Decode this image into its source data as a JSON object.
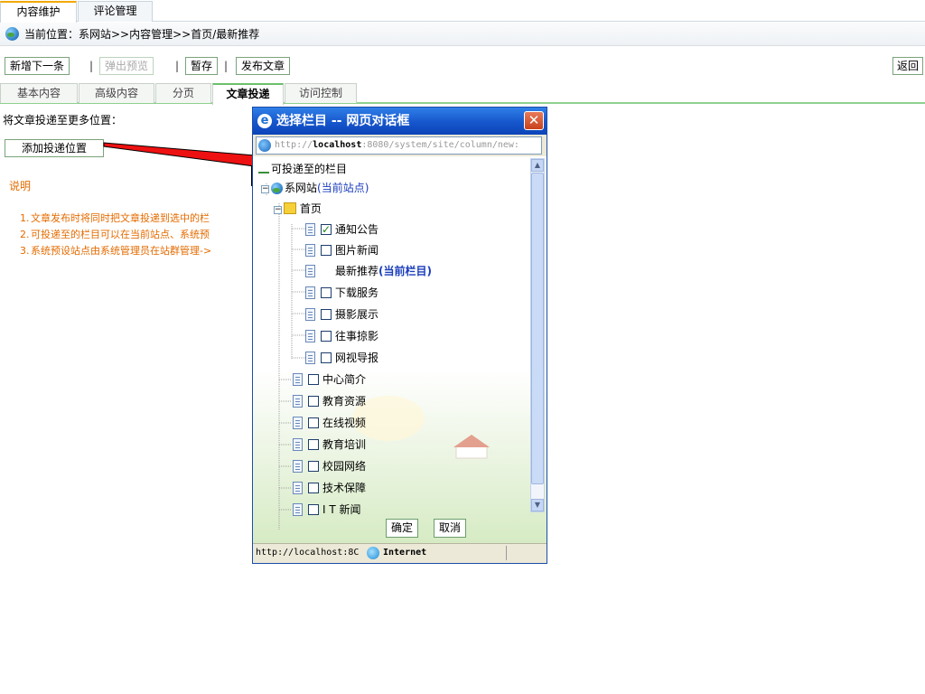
{
  "top_tabs": [
    {
      "label": "内容维护",
      "active": true
    },
    {
      "label": "评论管理",
      "active": false
    }
  ],
  "breadcrumb": "当前位置：系网站>>内容管理>>首页/最新推荐",
  "toolbar": {
    "new": "新增下一条",
    "preview": "弹出预览",
    "draft": "暂存",
    "publish": "发布文章",
    "back": "返回",
    "sep": "|"
  },
  "sub_tabs": [
    "基本内容",
    "高级内容",
    "分页",
    "文章投递",
    "访问控制"
  ],
  "page": {
    "label": "将文章投递至更多位置：",
    "add_button": "添加投递位置",
    "note_title": "说明",
    "notes": [
      {
        "num": "1.",
        "text": "文章发布时将同时把文章投递到选中的栏"
      },
      {
        "num": "2.",
        "text": "可投递至的栏目可以在当前站点、系统预"
      },
      {
        "num": "3.",
        "text": "系统预设站点由系统管理员在站群管理->"
      }
    ]
  },
  "dialog": {
    "title": "选择栏目 -- 网页对话框",
    "close": "✕",
    "address_prefix": "http://",
    "address_host": "localhost",
    "address_rest": ":8080/system/site/column/new:",
    "tree": {
      "root": "可投递至的栏目",
      "site": "系网站",
      "site_note": "(当前站点)",
      "home": "首页",
      "home_children": [
        {
          "label": "通知公告",
          "checked": true
        },
        {
          "label": "图片新闻",
          "checked": false
        },
        {
          "label": "最新推荐",
          "checked": false,
          "note": "(当前栏目)",
          "no_checkbox": true
        },
        {
          "label": "下载服务",
          "checked": false
        },
        {
          "label": "摄影展示",
          "checked": false
        },
        {
          "label": "往事掠影",
          "checked": false
        },
        {
          "label": "网视导报",
          "checked": false
        }
      ],
      "site_children": [
        {
          "label": "中心简介",
          "checked": false
        },
        {
          "label": "教育资源",
          "checked": false
        },
        {
          "label": "在线视频",
          "checked": false
        },
        {
          "label": "教育培训",
          "checked": false
        },
        {
          "label": "校园网络",
          "checked": false
        },
        {
          "label": "技术保障",
          "checked": false
        },
        {
          "label": "I T 新闻",
          "checked": false
        }
      ]
    },
    "ok": "确定",
    "cancel": "取消",
    "status_url": "http://localhost:8C",
    "status_zone": "Internet"
  }
}
